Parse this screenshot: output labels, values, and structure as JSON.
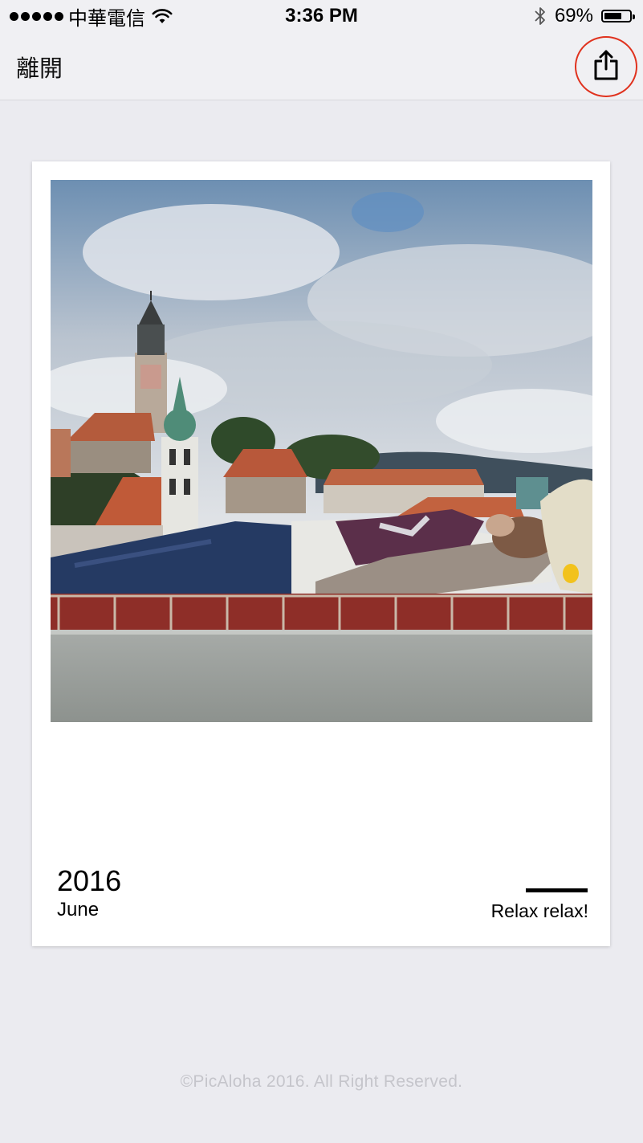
{
  "status_bar": {
    "carrier": "中華電信",
    "time": "3:36 PM",
    "battery_percent": "69%",
    "battery_level": 0.69,
    "icons": [
      "signal-dots-icon",
      "wifi-icon",
      "bluetooth-icon",
      "battery-icon"
    ]
  },
  "nav": {
    "back_label": "離開",
    "share_icon": "share-icon",
    "highlight_color": "#e0321e"
  },
  "card": {
    "year": "2016",
    "month": "June",
    "caption": "Relax relax!"
  },
  "footer": {
    "copyright": "©PicAloha 2016. All Right Reserved."
  }
}
